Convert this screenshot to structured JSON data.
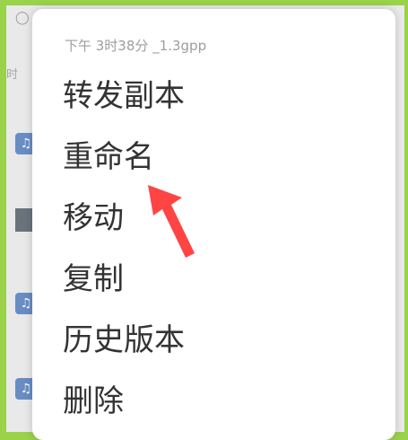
{
  "menu": {
    "header": "下午 3时38分 _1.3gpp",
    "items": [
      {
        "label": "转发副本"
      },
      {
        "label": "重命名"
      },
      {
        "label": "移动"
      },
      {
        "label": "复制"
      },
      {
        "label": "历史版本"
      },
      {
        "label": "删除"
      }
    ]
  },
  "background": {
    "icon_symbol": "♫"
  },
  "colors": {
    "frame_border": "#9ad24a",
    "arrow": "#ff4444"
  }
}
